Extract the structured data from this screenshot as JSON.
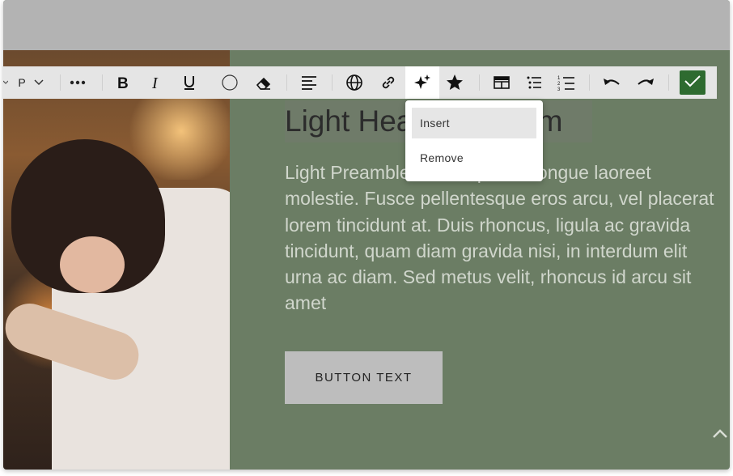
{
  "toolbar": {
    "paragraph_label": "P",
    "insert_menu": {
      "items": [
        {
          "label": "Insert"
        },
        {
          "label": "Remove"
        }
      ]
    }
  },
  "content": {
    "heading": "Light Heading Lorem",
    "preamble": "Light Preamble Lorem ipsum congue laoreet molestie. Fusce pellentesque eros arcu, vel placerat lorem tincidunt at. Duis rhoncus, ligula ac gravida tincidunt, quam diam gravida nisi, in interdum elit urna ac diam. Sed metus velit, rhoncus id arcu sit amet",
    "button_text": "BUTTON TEXT"
  },
  "colors": {
    "panel_background": "#6b7d64",
    "confirm_green": "#2e6b30",
    "toolbar_background": "#e5e5e5"
  },
  "icons": [
    "chevron-down-icon",
    "more-icon",
    "bold-icon",
    "italic-icon",
    "underline-icon",
    "color-circle-icon",
    "eraser-icon",
    "align-icon",
    "globe-icon",
    "link-icon",
    "sparkles-icon",
    "star-icon",
    "table-icon",
    "bulleted-list-icon",
    "numbered-list-icon",
    "undo-icon",
    "redo-icon",
    "check-icon",
    "chevron-up-icon"
  ]
}
